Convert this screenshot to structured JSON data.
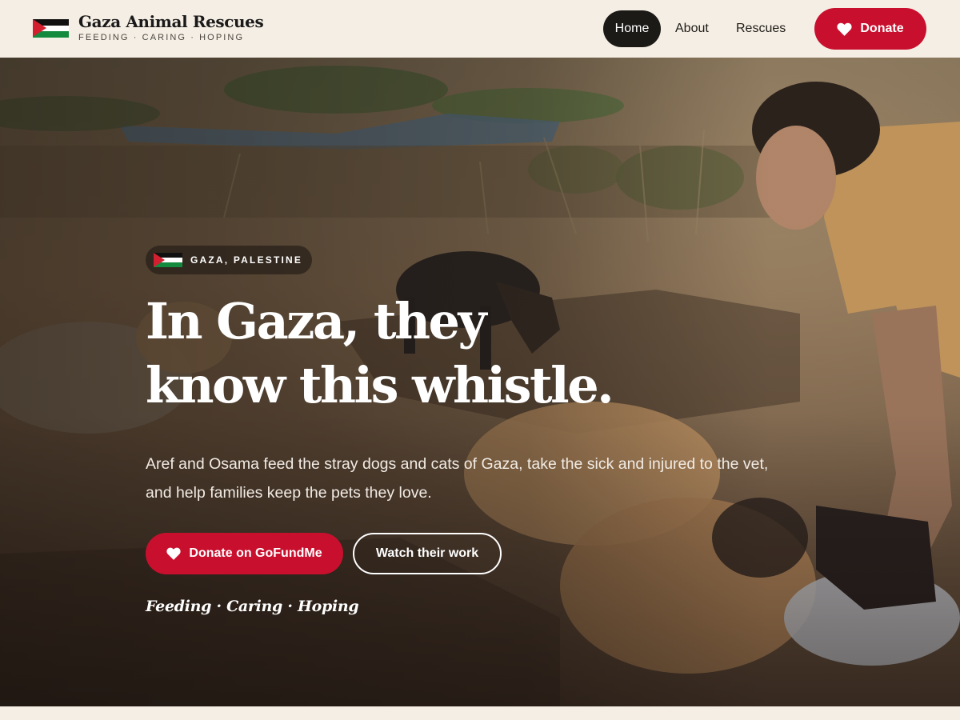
{
  "brand": {
    "title": "Gaza Animal Rescues",
    "tagline": "FEEDING · CARING · HOPING",
    "logo_icon": "palestine-flag-icon"
  },
  "nav": {
    "items": [
      {
        "label": "Home",
        "active": true
      },
      {
        "label": "About",
        "active": false
      },
      {
        "label": "Rescues",
        "active": false
      }
    ],
    "donate_label": "Donate",
    "donate_icon": "heart-icon"
  },
  "hero": {
    "location_badge": "GAZA, PALESTINE",
    "headline_line1": "In Gaza, they",
    "headline_line2": "know this whistle.",
    "subtext": "Aref and Osama feed the stray dogs and cats of Gaza, take the sick and injured to the vet, and help families keep the pets they love.",
    "cta_primary": "Donate on GoFundMe",
    "cta_secondary": "Watch their work",
    "motto": "Feeding · Caring · Hoping"
  },
  "colors": {
    "accent": "#c8102e",
    "background": "#f5eee4",
    "dark": "#1c1a17"
  }
}
